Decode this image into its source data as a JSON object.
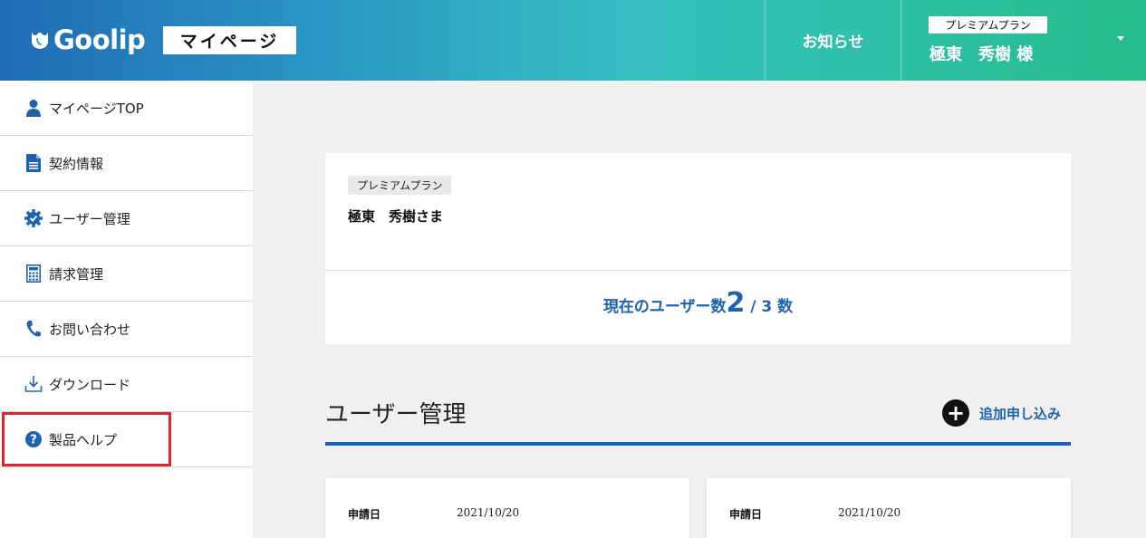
{
  "header": {
    "logo_text": "Goolip",
    "page_label": "マイページ",
    "news_label": "お知らせ",
    "plan_badge": "プレミアムプラン",
    "user_name": "極東　秀樹 様"
  },
  "sidebar": {
    "items": [
      {
        "label": "マイページTOP",
        "icon": "user-icon"
      },
      {
        "label": "契約情報",
        "icon": "document-icon"
      },
      {
        "label": "ユーザー管理",
        "icon": "gear-check-icon"
      },
      {
        "label": "請求管理",
        "icon": "calculator-icon"
      },
      {
        "label": "お問い合わせ",
        "icon": "phone-icon"
      },
      {
        "label": "ダウンロード",
        "icon": "download-icon"
      },
      {
        "label": "製品ヘルプ",
        "icon": "help-icon"
      }
    ]
  },
  "summary": {
    "plan_tag": "プレミアムプラン",
    "name": "極東　秀樹さま",
    "count_prefix": "現在のユーザー数",
    "count_current": "2",
    "count_suffix": " / 3 数"
  },
  "users_section": {
    "title": "ユーザー管理",
    "add_label": "追加申し込み",
    "cards": [
      {
        "date_label": "申請日",
        "date_value": "2021/10/20"
      },
      {
        "date_label": "申請日",
        "date_value": "2021/10/20"
      }
    ]
  },
  "colors": {
    "accent": "#1e63ad",
    "highlight": "#e0242b",
    "header_start": "#1f6bb5",
    "header_end": "#26bb8c"
  }
}
